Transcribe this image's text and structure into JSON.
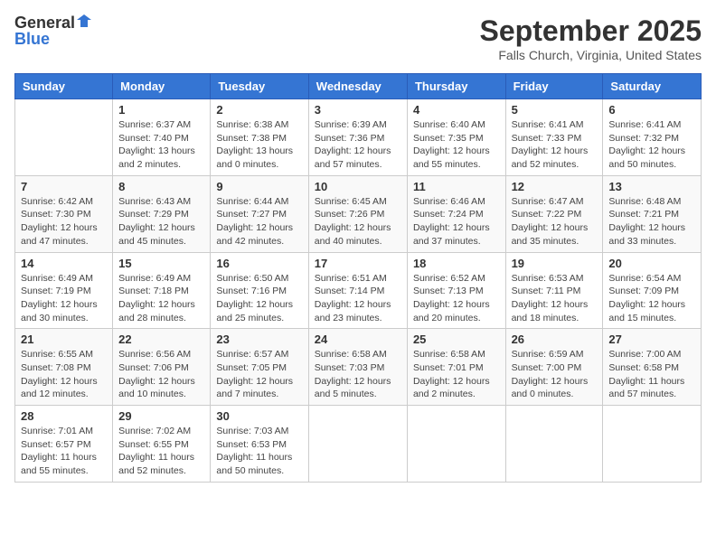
{
  "logo": {
    "general": "General",
    "blue": "Blue"
  },
  "title": "September 2025",
  "location": "Falls Church, Virginia, United States",
  "weekdays": [
    "Sunday",
    "Monday",
    "Tuesday",
    "Wednesday",
    "Thursday",
    "Friday",
    "Saturday"
  ],
  "weeks": [
    [
      {
        "day": "",
        "sunrise": "",
        "sunset": "",
        "daylight": ""
      },
      {
        "day": "1",
        "sunrise": "Sunrise: 6:37 AM",
        "sunset": "Sunset: 7:40 PM",
        "daylight": "Daylight: 13 hours and 2 minutes."
      },
      {
        "day": "2",
        "sunrise": "Sunrise: 6:38 AM",
        "sunset": "Sunset: 7:38 PM",
        "daylight": "Daylight: 13 hours and 0 minutes."
      },
      {
        "day": "3",
        "sunrise": "Sunrise: 6:39 AM",
        "sunset": "Sunset: 7:36 PM",
        "daylight": "Daylight: 12 hours and 57 minutes."
      },
      {
        "day": "4",
        "sunrise": "Sunrise: 6:40 AM",
        "sunset": "Sunset: 7:35 PM",
        "daylight": "Daylight: 12 hours and 55 minutes."
      },
      {
        "day": "5",
        "sunrise": "Sunrise: 6:41 AM",
        "sunset": "Sunset: 7:33 PM",
        "daylight": "Daylight: 12 hours and 52 minutes."
      },
      {
        "day": "6",
        "sunrise": "Sunrise: 6:41 AM",
        "sunset": "Sunset: 7:32 PM",
        "daylight": "Daylight: 12 hours and 50 minutes."
      }
    ],
    [
      {
        "day": "7",
        "sunrise": "Sunrise: 6:42 AM",
        "sunset": "Sunset: 7:30 PM",
        "daylight": "Daylight: 12 hours and 47 minutes."
      },
      {
        "day": "8",
        "sunrise": "Sunrise: 6:43 AM",
        "sunset": "Sunset: 7:29 PM",
        "daylight": "Daylight: 12 hours and 45 minutes."
      },
      {
        "day": "9",
        "sunrise": "Sunrise: 6:44 AM",
        "sunset": "Sunset: 7:27 PM",
        "daylight": "Daylight: 12 hours and 42 minutes."
      },
      {
        "day": "10",
        "sunrise": "Sunrise: 6:45 AM",
        "sunset": "Sunset: 7:26 PM",
        "daylight": "Daylight: 12 hours and 40 minutes."
      },
      {
        "day": "11",
        "sunrise": "Sunrise: 6:46 AM",
        "sunset": "Sunset: 7:24 PM",
        "daylight": "Daylight: 12 hours and 37 minutes."
      },
      {
        "day": "12",
        "sunrise": "Sunrise: 6:47 AM",
        "sunset": "Sunset: 7:22 PM",
        "daylight": "Daylight: 12 hours and 35 minutes."
      },
      {
        "day": "13",
        "sunrise": "Sunrise: 6:48 AM",
        "sunset": "Sunset: 7:21 PM",
        "daylight": "Daylight: 12 hours and 33 minutes."
      }
    ],
    [
      {
        "day": "14",
        "sunrise": "Sunrise: 6:49 AM",
        "sunset": "Sunset: 7:19 PM",
        "daylight": "Daylight: 12 hours and 30 minutes."
      },
      {
        "day": "15",
        "sunrise": "Sunrise: 6:49 AM",
        "sunset": "Sunset: 7:18 PM",
        "daylight": "Daylight: 12 hours and 28 minutes."
      },
      {
        "day": "16",
        "sunrise": "Sunrise: 6:50 AM",
        "sunset": "Sunset: 7:16 PM",
        "daylight": "Daylight: 12 hours and 25 minutes."
      },
      {
        "day": "17",
        "sunrise": "Sunrise: 6:51 AM",
        "sunset": "Sunset: 7:14 PM",
        "daylight": "Daylight: 12 hours and 23 minutes."
      },
      {
        "day": "18",
        "sunrise": "Sunrise: 6:52 AM",
        "sunset": "Sunset: 7:13 PM",
        "daylight": "Daylight: 12 hours and 20 minutes."
      },
      {
        "day": "19",
        "sunrise": "Sunrise: 6:53 AM",
        "sunset": "Sunset: 7:11 PM",
        "daylight": "Daylight: 12 hours and 18 minutes."
      },
      {
        "day": "20",
        "sunrise": "Sunrise: 6:54 AM",
        "sunset": "Sunset: 7:09 PM",
        "daylight": "Daylight: 12 hours and 15 minutes."
      }
    ],
    [
      {
        "day": "21",
        "sunrise": "Sunrise: 6:55 AM",
        "sunset": "Sunset: 7:08 PM",
        "daylight": "Daylight: 12 hours and 12 minutes."
      },
      {
        "day": "22",
        "sunrise": "Sunrise: 6:56 AM",
        "sunset": "Sunset: 7:06 PM",
        "daylight": "Daylight: 12 hours and 10 minutes."
      },
      {
        "day": "23",
        "sunrise": "Sunrise: 6:57 AM",
        "sunset": "Sunset: 7:05 PM",
        "daylight": "Daylight: 12 hours and 7 minutes."
      },
      {
        "day": "24",
        "sunrise": "Sunrise: 6:58 AM",
        "sunset": "Sunset: 7:03 PM",
        "daylight": "Daylight: 12 hours and 5 minutes."
      },
      {
        "day": "25",
        "sunrise": "Sunrise: 6:58 AM",
        "sunset": "Sunset: 7:01 PM",
        "daylight": "Daylight: 12 hours and 2 minutes."
      },
      {
        "day": "26",
        "sunrise": "Sunrise: 6:59 AM",
        "sunset": "Sunset: 7:00 PM",
        "daylight": "Daylight: 12 hours and 0 minutes."
      },
      {
        "day": "27",
        "sunrise": "Sunrise: 7:00 AM",
        "sunset": "Sunset: 6:58 PM",
        "daylight": "Daylight: 11 hours and 57 minutes."
      }
    ],
    [
      {
        "day": "28",
        "sunrise": "Sunrise: 7:01 AM",
        "sunset": "Sunset: 6:57 PM",
        "daylight": "Daylight: 11 hours and 55 minutes."
      },
      {
        "day": "29",
        "sunrise": "Sunrise: 7:02 AM",
        "sunset": "Sunset: 6:55 PM",
        "daylight": "Daylight: 11 hours and 52 minutes."
      },
      {
        "day": "30",
        "sunrise": "Sunrise: 7:03 AM",
        "sunset": "Sunset: 6:53 PM",
        "daylight": "Daylight: 11 hours and 50 minutes."
      },
      {
        "day": "",
        "sunrise": "",
        "sunset": "",
        "daylight": ""
      },
      {
        "day": "",
        "sunrise": "",
        "sunset": "",
        "daylight": ""
      },
      {
        "day": "",
        "sunrise": "",
        "sunset": "",
        "daylight": ""
      },
      {
        "day": "",
        "sunrise": "",
        "sunset": "",
        "daylight": ""
      }
    ]
  ]
}
